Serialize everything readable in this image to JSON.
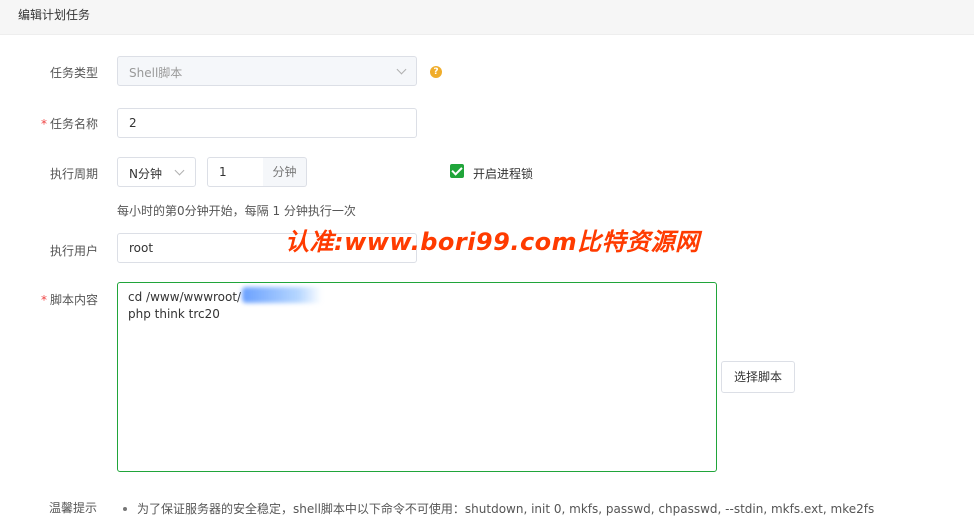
{
  "header": {
    "title": "编辑计划任务"
  },
  "form": {
    "task_type": {
      "label": "任务类型",
      "value": "Shell脚本",
      "help": "?"
    },
    "task_name": {
      "label": "任务名称",
      "required_mark": "*",
      "value": "2"
    },
    "period": {
      "label": "执行周期",
      "unit_select": "N分钟",
      "number": "1",
      "suffix": "分钟",
      "lock_checked": true,
      "lock_label": "开启进程锁",
      "hint": "每小时的第0分钟开始，每隔 1 分钟执行一次"
    },
    "user": {
      "label": "执行用户",
      "value": "root"
    },
    "script": {
      "label": "脚本内容",
      "required_mark": "*",
      "content": "cd /www/wwwroot/\nphp think trc20",
      "choose_button": "选择脚本"
    },
    "tips": {
      "label": "温馨提示",
      "items": [
        "为了保证服务器的安全稳定，shell脚本中以下命令不可使用：shutdown, init 0, mkfs, passwd, chpasswd, --stdin, mkfs.ext, mke2fs"
      ]
    }
  },
  "watermark": "认准:www.bori99.com比特资源网",
  "colors": {
    "accent": "#20a53a",
    "required": "#ef4444",
    "help": "#f0ad2b",
    "watermark": "#ff3b00"
  }
}
